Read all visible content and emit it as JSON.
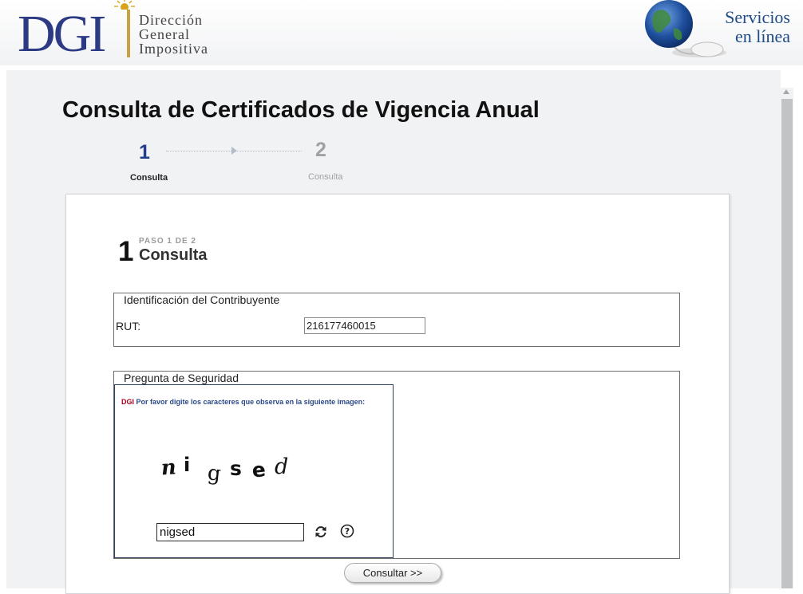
{
  "header": {
    "logo_letters": "DGI",
    "logo_name_lines": [
      "Dirección",
      "General",
      "Impositiva"
    ],
    "servicios_line1": "Servicios",
    "servicios_line2": "en línea"
  },
  "page_title": "Consulta de Certificados de Vigencia Anual",
  "steps": [
    {
      "number": "1",
      "label": "Consulta",
      "active": true
    },
    {
      "number": "2",
      "label": "Consulta",
      "active": false
    }
  ],
  "current_step": {
    "number": "1",
    "paso_label": "PASO 1 DE 2",
    "title": "Consulta"
  },
  "identificacion": {
    "legend": "Identificación del Contribuyente",
    "rut_label": "RUT:",
    "rut_value": "216177460015"
  },
  "seguridad": {
    "legend": "Pregunta de Seguridad",
    "instr_prefix": "DGI",
    "instr_text": "Por favor digite los caracteres que observa en la siguiente imagen:",
    "captcha_chars": [
      "n",
      "i",
      "g",
      "s",
      "e",
      "d"
    ],
    "captcha_input_value": "nigsed",
    "refresh_icon": "refresh-icon",
    "help_icon": "help-icon"
  },
  "consultar_label": "Consultar >>",
  "colors": {
    "brand_blue": "#2c3a84",
    "brand_gold": "#c6a245",
    "step_active": "#203e8a",
    "step_inactive": "#9ea1a6",
    "instr_blue": "#2b4a8a",
    "instr_red": "#b00020"
  }
}
